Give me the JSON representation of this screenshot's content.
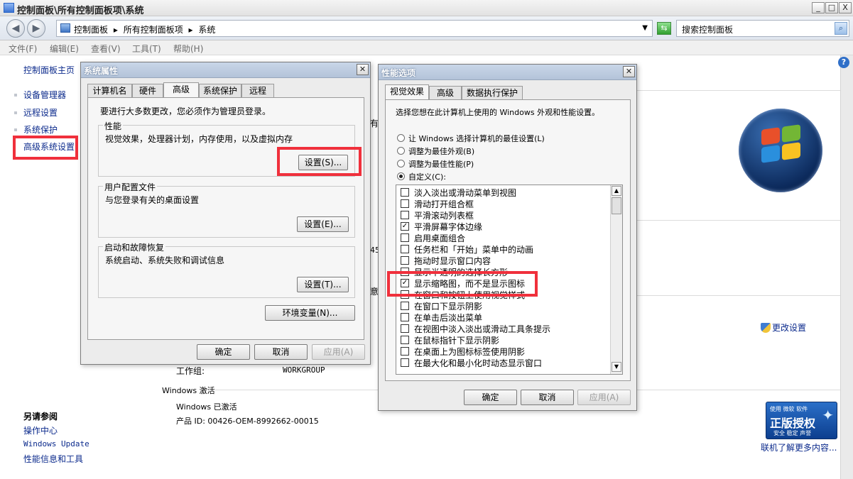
{
  "window": {
    "title": "控制面板\\所有控制面板项\\系统",
    "min": "_",
    "max": "□",
    "close": "X"
  },
  "address": {
    "crumbs": [
      "控制面板",
      "▸",
      "所有控制面板项",
      "▸",
      "系统"
    ],
    "search_placeholder": "搜索控制面板"
  },
  "menu": [
    "文件(F)",
    "编辑(E)",
    "查看(V)",
    "工具(T)",
    "帮助(H)"
  ],
  "left_pane": {
    "home": "控制面板主页",
    "links": [
      "设备管理器",
      "远程设置",
      "系统保护",
      "高级系统设置"
    ],
    "see_also_title": "另请参阅",
    "see_also": [
      "操作中心",
      "Windows Update",
      "性能信息和工具"
    ]
  },
  "main": {
    "workgroup_label": "工作组:",
    "workgroup_value": "WORKGROUP",
    "activation_section": "Windows 激活",
    "activation_status": "Windows 已激活",
    "product_id": "产品 ID: 00426-OEM-8992662-00015",
    "change_settings": "更改设置",
    "learn_more": "联机了解更多内容...",
    "partial_1": "有",
    "partial_2": "45",
    "partial_3": "意",
    "license_badge": {
      "top": "使用 微软 软件",
      "main": "正版授权",
      "sub": "安全 稳定 声誉"
    }
  },
  "sys_props": {
    "title": "系统属性",
    "tabs": [
      "计算机名",
      "硬件",
      "高级",
      "系统保护",
      "远程"
    ],
    "admin_note": "要进行大多数更改，您必须作为管理员登录。",
    "performance": {
      "label": "性能",
      "desc": "视觉效果，处理器计划，内存使用，以及虚拟内存",
      "button": "设置(S)..."
    },
    "user_profiles": {
      "label": "用户配置文件",
      "desc": "与您登录有关的桌面设置",
      "button": "设置(E)..."
    },
    "startup_recovery": {
      "label": "启动和故障恢复",
      "desc": "系统启动、系统失败和调试信息",
      "button": "设置(T)..."
    },
    "env_button": "环境变量(N)...",
    "ok": "确定",
    "cancel": "取消",
    "apply": "应用(A)"
  },
  "perf_options": {
    "title": "性能选项",
    "tabs": [
      "视觉效果",
      "高级",
      "数据执行保护"
    ],
    "intro": "选择您想在此计算机上使用的 Windows 外观和性能设置。",
    "radios": [
      {
        "label": "让 Windows 选择计算机的最佳设置(L)",
        "checked": false
      },
      {
        "label": "调整为最佳外观(B)",
        "checked": false
      },
      {
        "label": "调整为最佳性能(P)",
        "checked": false
      },
      {
        "label": "自定义(C):",
        "checked": true
      }
    ],
    "items": [
      {
        "label": "淡入淡出或滑动菜单到视图",
        "checked": false
      },
      {
        "label": "滑动打开组合框",
        "checked": false
      },
      {
        "label": "平滑滚动列表框",
        "checked": false
      },
      {
        "label": "平滑屏幕字体边缘",
        "checked": true
      },
      {
        "label": "启用桌面组合",
        "checked": false
      },
      {
        "label": "任务栏和「开始」菜单中的动画",
        "checked": false
      },
      {
        "label": "拖动时显示窗口内容",
        "checked": false
      },
      {
        "label": "显示半透明的选择长方形",
        "checked": false
      },
      {
        "label": "显示缩略图，而不是显示图标",
        "checked": true
      },
      {
        "label": "在窗口和按钮上使用视觉样式",
        "checked": false
      },
      {
        "label": "在窗口下显示阴影",
        "checked": false
      },
      {
        "label": "在单击后淡出菜单",
        "checked": false
      },
      {
        "label": "在视图中淡入淡出或滑动工具条提示",
        "checked": false
      },
      {
        "label": "在鼠标指针下显示阴影",
        "checked": false
      },
      {
        "label": "在桌面上为图标标签使用阴影",
        "checked": false
      },
      {
        "label": "在最大化和最小化时动态显示窗口",
        "checked": false
      }
    ],
    "ok": "确定",
    "cancel": "取消",
    "apply": "应用(A)"
  },
  "colors": {
    "highlight_red": "#f0303c",
    "link_blue": "#0b2a8c"
  }
}
